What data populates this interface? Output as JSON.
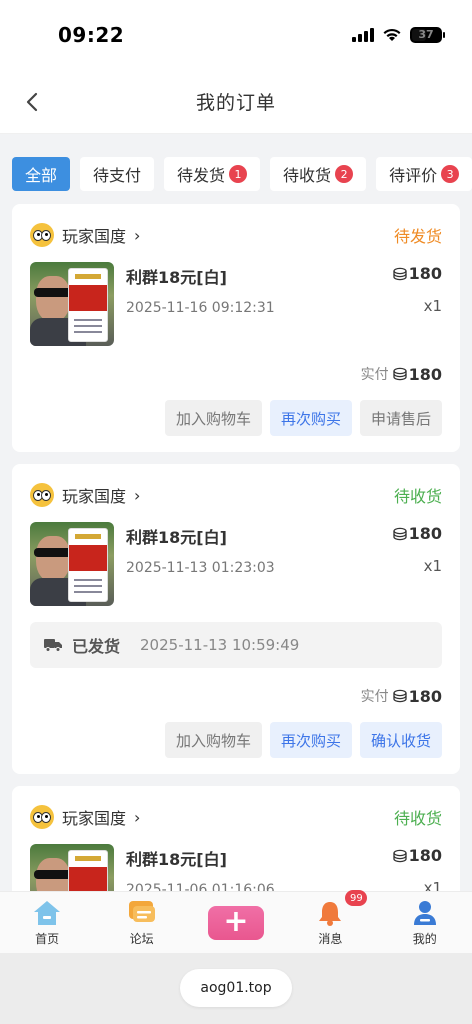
{
  "status_bar": {
    "time": "09:22",
    "battery": "37"
  },
  "nav": {
    "title": "我的订单"
  },
  "tabs": [
    {
      "label": "全部",
      "active": true,
      "badge": ""
    },
    {
      "label": "待支付",
      "active": false,
      "badge": ""
    },
    {
      "label": "待发货",
      "active": false,
      "badge": "1"
    },
    {
      "label": "待收货",
      "active": false,
      "badge": "2"
    },
    {
      "label": "待评价",
      "active": false,
      "badge": "3"
    }
  ],
  "orders": [
    {
      "shop_name": "玩家国度",
      "status": "待发货",
      "item_name": "利群18元[白]",
      "date": "2025-11-16 09:12:31",
      "price": "180",
      "qty": "x1",
      "paid_label": "实付",
      "paid": "180",
      "actions": [
        "加入购物车",
        "再次购买",
        "申请售后"
      ]
    },
    {
      "shop_name": "玩家国度",
      "status": "待收货",
      "item_name": "利群18元[白]",
      "date": "2025-11-13 01:23:03",
      "price": "180",
      "qty": "x1",
      "ship_label": "已发货",
      "ship_time": "2025-11-13 10:59:49",
      "paid_label": "实付",
      "paid": "180",
      "actions": [
        "加入购物车",
        "再次购买",
        "确认收货"
      ]
    },
    {
      "shop_name": "玩家国度",
      "status": "待收货",
      "item_name": "利群18元[白]",
      "date": "2025-11-06 01:16:06",
      "price": "180",
      "qty": "x1"
    }
  ],
  "tabbar": {
    "home": "首页",
    "forum": "论坛",
    "messages": "消息",
    "messages_badge": "99",
    "mine": "我的"
  },
  "url": "aog01.top",
  "colors": {
    "accent": "#3d8fe0",
    "pending_ship": "#ef8b25",
    "pending_receive": "#4caf50",
    "badge": "#e8434f"
  }
}
